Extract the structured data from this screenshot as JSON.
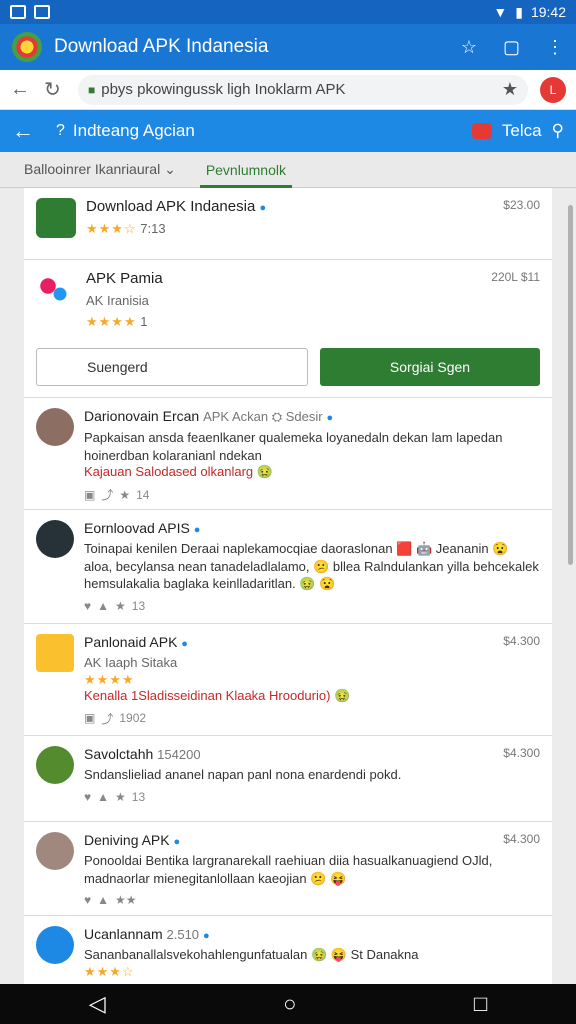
{
  "status": {
    "time": "19:42"
  },
  "appbar": {
    "title": "Download APK Indanesia"
  },
  "browser": {
    "url": "pbys pkowingussk ligh Inoklarm APK",
    "avatar": "L"
  },
  "topnav": {
    "title": "Indteang Agcian",
    "right_label": "Telca"
  },
  "tabs": [
    {
      "label": "Ballooinrer Ikanriaural ⌄"
    },
    {
      "label": "Pevnlumnolk"
    }
  ],
  "apps": [
    {
      "name": "Download APK Indanesia",
      "rating_text": "7:13",
      "price": "$23.00"
    },
    {
      "name": "APK Pamia",
      "subtitle": "AK Iranisia",
      "rating_text": "1",
      "price": "220L $11"
    }
  ],
  "buttons": {
    "outline": "Suengerd",
    "green": "Sorgiai Sgen"
  },
  "reviews": [
    {
      "name": "Darionovain Ercan",
      "secondary": "APK Ackan ⛭ Sdesir",
      "text": "Papkaisan ansda feaenlkaner qualemeka loyanedaln dekan lam lapedan hoinerdban kolaranianl ndekan",
      "red": "Kajauan Salodased olkanlarg 🤢",
      "count": "14"
    },
    {
      "name": "Eornloovad APIS",
      "text": "Toinapai kenilen Deraai naplekamocqiae daoraslonan 🟥 🤖 Jeananin 😧 aloa, becylansa nean tanadeladlalamo, 😕 bllea Ralndulankan yilla behcekalek hemsulakalia baglaka keinlladaritlan. 🤢 😧",
      "count": "13"
    },
    {
      "name": "Panlonaid APK",
      "secondary": "AK Iaaph Sitaka",
      "red": "Kenalla 1Sladisseidinan Klaaka Hroodurio) 🤢",
      "count": "1902",
      "price": "$4.300"
    },
    {
      "name": "Savolctahh",
      "secondary": "154200",
      "text": "Sndanslieliad ananel napan panl nona enardendi pokd.",
      "count": "13",
      "price": "$4.300"
    },
    {
      "name": "Deniving APK",
      "text": "Ponooldai Bentika largranarekall raehiuan diia hasualkanuagiend OJld, madnaorlar mienegitanlollaan kaeojian 😕 😝",
      "price": "$4.300"
    },
    {
      "name": "Ucanlannam",
      "secondary": "2.510",
      "text": "Sananbanallalsvekohahlengunfatualan 🤢 😝 St Danakna"
    }
  ]
}
